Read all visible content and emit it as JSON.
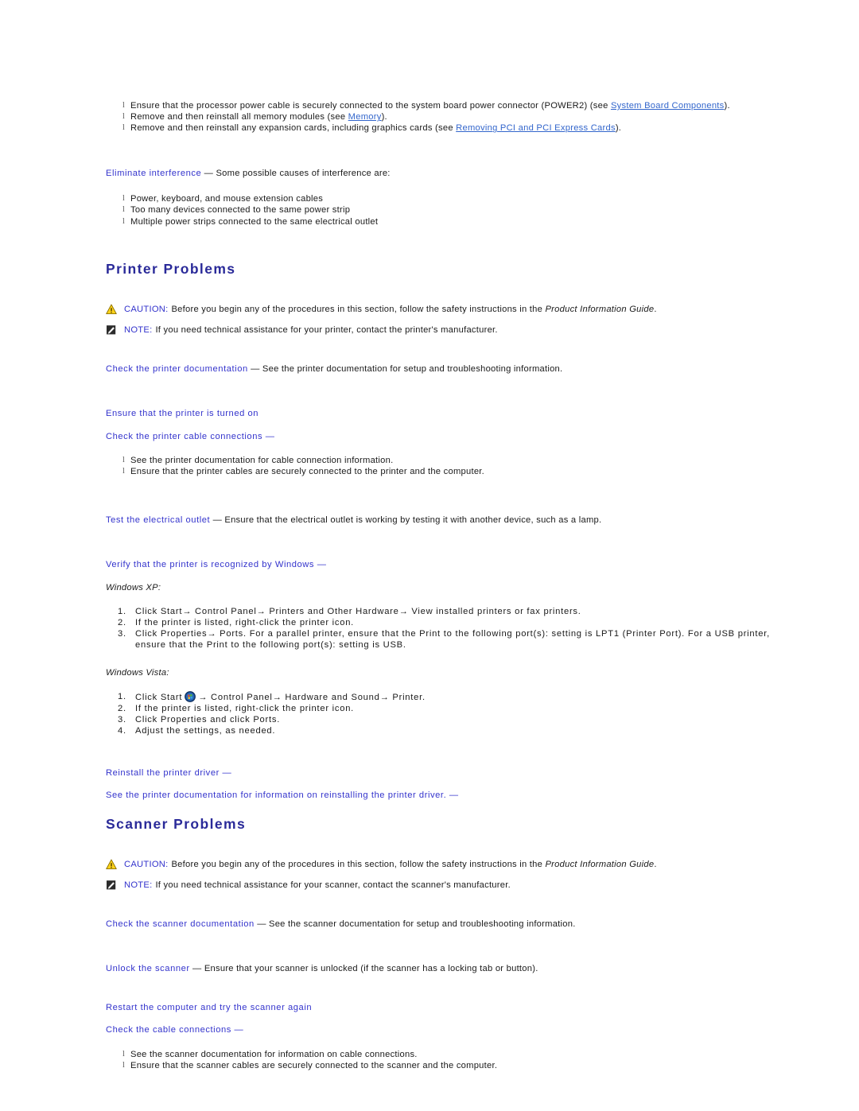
{
  "document": {
    "top_bullets": [
      {
        "pre": "Ensure that the processor power cable is securely connected to the system board power connector (POWER2) (see ",
        "link": "System Board Components",
        "post": ")."
      },
      {
        "pre": "Remove and then reinstall all memory modules (see ",
        "link": "Memory",
        "post": ")."
      },
      {
        "pre": "Remove and then reinstall any expansion cards, including graphics cards (see ",
        "link": "Removing PCI and PCI Express Cards",
        "post": ")."
      }
    ],
    "interference": {
      "heading": "Eliminate interference",
      "dash": " — ",
      "rest": "Some possible causes of interference are:",
      "bullets": [
        "Power, keyboard, and mouse extension cables",
        "Too many devices connected to the same power strip",
        "Multiple power strips connected to the same electrical outlet"
      ]
    },
    "printer_section": {
      "title": "Printer Problems",
      "caution": {
        "label": "CAUTION:",
        "text_before": " Before you begin any of the procedures in this section, follow the safety instructions in the ",
        "italic": "Product Information Guide",
        "text_after": "."
      },
      "note": {
        "label": "NOTE:",
        "text": " If you need technical assistance for your printer, contact the printer's manufacturer."
      },
      "check_doc": {
        "heading": "Check the printer documentation",
        "dash": " — ",
        "rest": "See the printer documentation for setup and troubleshooting information."
      },
      "turned_on": "Ensure that the printer is turned on",
      "cable_connections": {
        "heading": "Check the printer cable connections",
        "dash": " —",
        "bullets": [
          "See the printer documentation for cable connection information.",
          "Ensure that the printer cables are securely connected to the printer and the computer."
        ]
      },
      "electrical_outlet": {
        "heading": "Test the electrical outlet",
        "dash": " — ",
        "rest": "Ensure that the electrical outlet is working by testing it with another device, such as a lamp."
      },
      "verify_printer": {
        "heading": "Verify that the printer is recognized by Windows",
        "dash": " —"
      },
      "windows_xp": {
        "label": "Windows XP:",
        "steps": [
          "Click Start→ Control Panel→ Printers and Other Hardware→ View installed printers or fax printers.",
          "If the printer is listed, right-click the printer icon.",
          "Click Properties→ Ports. For a parallel printer, ensure that the Print to the following port(s): setting is LPT1 (Printer Port). For a USB printer, ensure that the Print to the following port(s): setting is USB."
        ]
      },
      "windows_vista": {
        "label": "Windows Vista:",
        "step1_pre": "Click Start",
        "step1_post": "→ Control Panel→ Hardware and Sound→ Printer.",
        "steps_rest": [
          "If the printer is listed, right-click the printer icon.",
          "Click Properties and click Ports.",
          "Adjust the settings, as needed."
        ]
      },
      "reinstall_driver": {
        "heading": "Reinstall the printer driver",
        "dash": " —"
      },
      "see_doc_reinstall": {
        "heading": "See the printer documentation for information on reinstalling the printer driver.",
        "dash": " —"
      }
    },
    "scanner_section": {
      "title": "Scanner Problems",
      "caution": {
        "label": "CAUTION:",
        "text_before": " Before you begin any of the procedures in this section, follow the safety instructions in the ",
        "italic": "Product Information Guide",
        "text_after": "."
      },
      "note": {
        "label": "NOTE:",
        "text": " If you need technical assistance for your scanner, contact the scanner's manufacturer."
      },
      "check_doc": {
        "heading": "Check the scanner documentation",
        "dash": " — ",
        "rest": "See the scanner documentation for setup and troubleshooting information."
      },
      "unlock": {
        "heading": "Unlock the scanner",
        "dash": " — ",
        "rest": "Ensure that your scanner is unlocked (if the scanner has a locking tab or button)."
      },
      "restart": "Restart the computer and try the scanner again",
      "cable_connections": {
        "heading": "Check the cable connections",
        "dash": " —",
        "bullets": [
          "See the scanner documentation for information on cable connections.",
          "Ensure that the scanner cables are securely connected to the scanner and the computer."
        ]
      }
    },
    "icons": {
      "caution": "warning-triangle-icon",
      "note": "note-pencil-icon",
      "vista_start": "windows-vista-start-orb-icon"
    },
    "colors": {
      "heading": "#2a2a99",
      "subheading": "#3333cc",
      "link": "#3366cc",
      "body": "#1a1a1a",
      "caution_icon": "#ffd700"
    }
  }
}
